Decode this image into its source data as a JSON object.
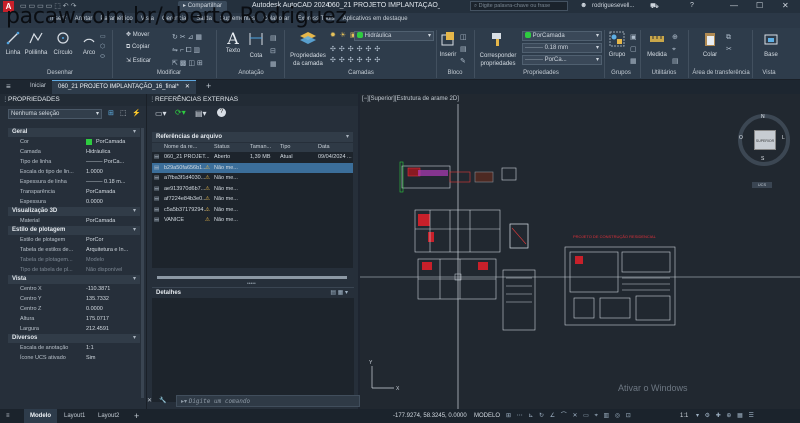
{
  "title_bar": {
    "app_title": "Autodesk AutoCAD 2024",
    "file_title": "060_21 PROJETO IMPLANTAÇÃO_16_final.dwg",
    "share": "Compartilhar",
    "search_placeholder": "Digite palavra-chave ou frase",
    "user": "rodriguesevell...",
    "watermark": "pacaw.com.br/oberto Rodriguez"
  },
  "ribbon_tabs": [
    "Inserir",
    "Anotar",
    "Paramétrico",
    "Vista",
    "Gerenciar",
    "Saída",
    "Suplementos",
    "Colaborar",
    "Express Tools",
    "Aplicativos em destaque"
  ],
  "ribbon": {
    "draw": {
      "buttons": [
        "Linha",
        "Polilinha",
        "Círculo",
        "Arco"
      ],
      "label": "Desenhar"
    },
    "modify": {
      "buttons": [
        "Mover",
        "Copiar",
        "Esticar"
      ],
      "label": "Modificar"
    },
    "annotation": {
      "buttons": [
        "Texto",
        "Cota"
      ],
      "label": "Anotação"
    },
    "layers": {
      "props_button": "Propriedades da camada",
      "current_layer": "Hidráulica",
      "label": "Camadas"
    },
    "block": {
      "button": "Inserir",
      "label": "Bloco"
    },
    "properties": {
      "match": "Corresponder propriedades",
      "color": "PorCamada",
      "lineweight": "0.18 mm",
      "linetype": "PorCa...",
      "label": "Propriedades"
    },
    "groups": {
      "button": "Grupo",
      "label": "Grupos"
    },
    "utilities": {
      "button": "Medida",
      "label": "Utilitários"
    },
    "clipboard": {
      "button": "Colar",
      "label": "Área de transferência"
    },
    "view": {
      "button": "Base",
      "label": "Vista"
    }
  },
  "doc_tabs": {
    "home": "Iniciar",
    "active": "060_21 PROJETO IMPLANTAÇÃO_16_final*"
  },
  "properties_panel": {
    "title": "PROPRIEDADES",
    "selection": "Nenhuma seleção",
    "sections": [
      {
        "name": "Geral",
        "rows": [
          [
            "Cor",
            "PorCamada"
          ],
          [
            "Camada",
            "Hidráulica"
          ],
          [
            "Tipo de linha",
            "——— PorCa..."
          ],
          [
            "Escala do tipo de lin...",
            "1.0000"
          ],
          [
            "Espessura de linha",
            "——— 0.18 m..."
          ],
          [
            "Transparência",
            "PorCamada"
          ],
          [
            "Espessura",
            "0.0000"
          ]
        ]
      },
      {
        "name": "Visualização 3D",
        "rows": [
          [
            "Material",
            "PorCamada"
          ]
        ]
      },
      {
        "name": "Estilo de plotagem",
        "rows": [
          [
            "Estilo de plotagem",
            "PorCor"
          ],
          [
            "Tabela de estilos de...",
            "Arquitetura e In..."
          ],
          [
            "Tabela de plotagem...",
            "Modelo"
          ],
          [
            "Tipo de tabela de pl...",
            "Não disponível"
          ]
        ]
      },
      {
        "name": "Vista",
        "rows": [
          [
            "Centro X",
            "-110.3871"
          ],
          [
            "Centro Y",
            "135.7332"
          ],
          [
            "Centro Z",
            "0.0000"
          ],
          [
            "Altura",
            "175.0717"
          ],
          [
            "Largura",
            "212.4591"
          ]
        ]
      },
      {
        "name": "Diversos",
        "rows": [
          [
            "Escala de anotação",
            "1:1"
          ],
          [
            "Ícone UCS ativado",
            "Sim"
          ]
        ]
      }
    ]
  },
  "xref_panel": {
    "title": "REFERÊNCIAS EXTERNAS",
    "section": "Referências de arquivo",
    "columns": [
      "Nome da re...",
      "Status",
      "Taman...",
      "Tipo",
      "Data"
    ],
    "rows": [
      [
        "060_21 PROJET...",
        "Aberto",
        "1,39 MB",
        "Atual",
        "09/04/2024 ..."
      ],
      [
        "b29a50fa656b1...",
        "Não me...",
        "",
        "",
        ""
      ],
      [
        "a7fba3f1d4030...",
        "Não me...",
        "",
        "",
        ""
      ],
      [
        "ae913970d6b7...",
        "Não me...",
        "",
        "",
        ""
      ],
      [
        "af7224e84b3e0...",
        "Não me...",
        "",
        "",
        ""
      ],
      [
        "c5a5b37179294...",
        "Não me...",
        "",
        "",
        ""
      ],
      [
        "VANICE",
        "Não me...",
        "",
        "",
        ""
      ]
    ],
    "details": "Detalhes"
  },
  "viewport": {
    "label": "[−][Superior][Estrutura de arame 2D]",
    "viewcube_face": "SUPERIOR",
    "compass": {
      "n": "N",
      "s": "S",
      "l": "L",
      "o": "O"
    },
    "ucs": "UCS",
    "activate_windows": "Ativar o Windows",
    "red_caption": "PROJETO DE CONSTRUÇÃO RESIDENCIAL"
  },
  "command": {
    "placeholder": "Digite um comando"
  },
  "status_bar": {
    "tabs": [
      "Modelo",
      "Layout1",
      "Layout2"
    ],
    "coords": "-177.9274, 58.3245, 0.0000",
    "mode": "MODELO",
    "scale": "1:1"
  }
}
